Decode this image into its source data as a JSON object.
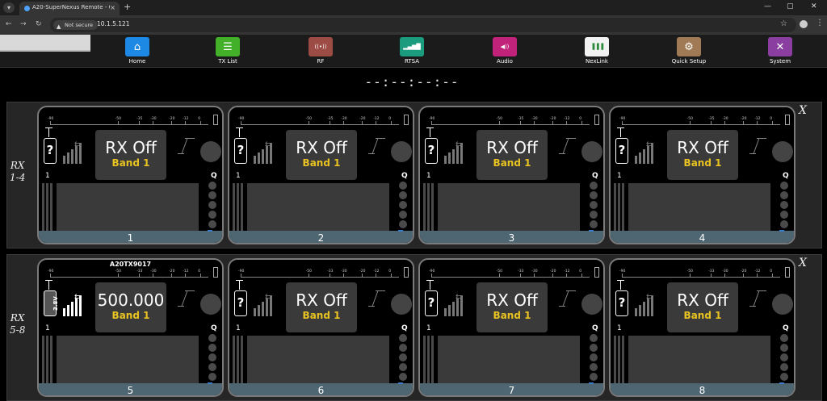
{
  "browser": {
    "tab_title": "A20-SuperNexus Remote - Con",
    "tab_close": "×",
    "new_tab": "+",
    "tab_menu": "▾",
    "security_label": "Not secure",
    "url": "10.1.5.121",
    "win_min": "—",
    "win_max": "▢",
    "win_close": "✕",
    "back": "←",
    "forward": "→",
    "reload": "↻",
    "star": "☆",
    "menu": "⋮"
  },
  "nav": {
    "items": [
      {
        "label": "Home",
        "icon": "home-icon",
        "glyph": "⌂",
        "color": "#1e88e5"
      },
      {
        "label": "TX List",
        "icon": "list-icon",
        "glyph": "☰",
        "color": "#43b02a"
      },
      {
        "label": "RF",
        "icon": "antenna-icon",
        "glyph": "((•))",
        "color": "#9c4b45"
      },
      {
        "label": "RTSA",
        "icon": "spectrum-icon",
        "glyph": "▂▄▆█",
        "color": "#1c9c7e"
      },
      {
        "label": "Audio",
        "icon": "speaker-icon",
        "glyph": "◀))",
        "color": "#c2237a"
      },
      {
        "label": "NexLink",
        "icon": "nexlink-icon",
        "glyph": "▐▐▐",
        "color": "#f2f2f2"
      },
      {
        "label": "Quick Setup",
        "icon": "gear-icon",
        "glyph": "⚙",
        "color": "#a07a55"
      },
      {
        "label": "System",
        "icon": "tools-icon",
        "glyph": "✕",
        "color": "#8a3fa0"
      }
    ]
  },
  "status": {
    "time": "--:--:--:--"
  },
  "groups": [
    {
      "label_line1": "RX",
      "label_line2": "1-4",
      "close": "X",
      "cards": [
        {
          "number": "1",
          "tx_name": "",
          "freq": "RX Off",
          "band": "Band 1",
          "battery": "?",
          "ch": "1",
          "q": "Q"
        },
        {
          "number": "2",
          "tx_name": "",
          "freq": "RX Off",
          "band": "Band 1",
          "battery": "?",
          "ch": "1",
          "q": "Q"
        },
        {
          "number": "3",
          "tx_name": "",
          "freq": "RX Off",
          "band": "Band 1",
          "battery": "?",
          "ch": "1",
          "q": "Q"
        },
        {
          "number": "4",
          "tx_name": "",
          "freq": "RX Off",
          "band": "Band 1",
          "battery": "?",
          "ch": "1",
          "q": "Q"
        }
      ]
    },
    {
      "label_line1": "RX",
      "label_line2": "5-8",
      "close": "X",
      "cards": [
        {
          "number": "5",
          "tx_name": "A20TX9017",
          "freq": "500.000",
          "band": "Band 1",
          "battery": "3.8V",
          "ch": "1",
          "q": "Q"
        },
        {
          "number": "6",
          "tx_name": "",
          "freq": "RX Off",
          "band": "Band 1",
          "battery": "?",
          "ch": "1",
          "q": "Q"
        },
        {
          "number": "7",
          "tx_name": "",
          "freq": "RX Off",
          "band": "Band 1",
          "battery": "?",
          "ch": "1",
          "q": "Q"
        },
        {
          "number": "8",
          "tx_name": "",
          "freq": "RX Off",
          "band": "Band 1",
          "battery": "?",
          "ch": "1",
          "q": "Q"
        }
      ]
    }
  ],
  "meter_labels": [
    "-90",
    "-50",
    "-35",
    "-30",
    "-20",
    "-12",
    "0"
  ],
  "meter_labels_alt": [
    "-90",
    "-50",
    "-33",
    "-30",
    "-20",
    "-12",
    "0"
  ]
}
